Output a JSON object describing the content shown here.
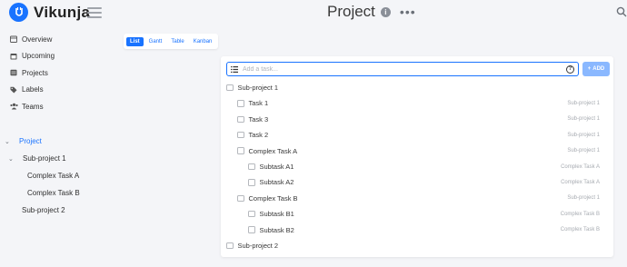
{
  "app": {
    "name": "Vikunja",
    "brand_color": "#1973ff"
  },
  "header": {
    "title": "Project",
    "info_icon": "info-icon",
    "more_icon": "ellipsis-icon",
    "search_icon": "search-icon"
  },
  "sidebar": {
    "nav": [
      {
        "label": "Overview",
        "icon": "calendar-icon"
      },
      {
        "label": "Upcoming",
        "icon": "calendar-icon"
      },
      {
        "label": "Projects",
        "icon": "layers-icon"
      },
      {
        "label": "Labels",
        "icon": "tags-icon"
      },
      {
        "label": "Teams",
        "icon": "users-icon"
      }
    ],
    "tree": [
      {
        "label": "Project",
        "active": true,
        "expanded": true
      },
      {
        "label": "Sub-project 1",
        "active": false,
        "expanded": true
      },
      {
        "label": "Complex Task A",
        "active": false
      },
      {
        "label": "Complex Task B",
        "active": false
      },
      {
        "label": "Sub-project 2",
        "active": false
      }
    ]
  },
  "views": {
    "items": [
      "List",
      "Gantt",
      "Table",
      "Kanban"
    ],
    "selected": "List"
  },
  "add_task": {
    "placeholder": "Add a task...",
    "button_label": "ADD",
    "button_icon": "plus-icon"
  },
  "tasks": [
    {
      "title": "Sub-project 1",
      "parent": "",
      "level": 0
    },
    {
      "title": "Task 1",
      "parent": "Sub-project 1",
      "level": 1
    },
    {
      "title": "Task 3",
      "parent": "Sub-project 1",
      "level": 1
    },
    {
      "title": "Task 2",
      "parent": "Sub-project 1",
      "level": 1
    },
    {
      "title": "Complex Task A",
      "parent": "Sub-project 1",
      "level": 1
    },
    {
      "title": "Subtask A1",
      "parent": "Complex Task A",
      "level": 2
    },
    {
      "title": "Subtask A2",
      "parent": "Complex Task A",
      "level": 2
    },
    {
      "title": "Complex Task B",
      "parent": "Sub-project 1",
      "level": 1
    },
    {
      "title": "Subtask B1",
      "parent": "Complex Task B",
      "level": 2
    },
    {
      "title": "Subtask B2",
      "parent": "Complex Task B",
      "level": 2
    },
    {
      "title": "Sub-project 2",
      "parent": "",
      "level": 0
    }
  ]
}
